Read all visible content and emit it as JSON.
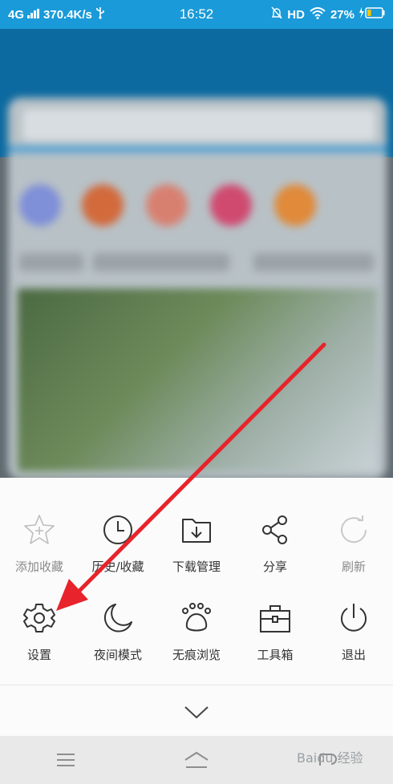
{
  "status_bar": {
    "network": "4G",
    "speed": "370.4K/s",
    "time": "16:52",
    "right_text": "HD",
    "battery": "27%",
    "battery_level": 0.27
  },
  "menu": {
    "rows": [
      [
        {
          "label": "添加收藏",
          "icon": "star-plus-icon",
          "enabled": false
        },
        {
          "label": "历史/收藏",
          "icon": "clock-icon",
          "enabled": true
        },
        {
          "label": "下载管理",
          "icon": "folder-download-icon",
          "enabled": true
        },
        {
          "label": "分享",
          "icon": "share-icon",
          "enabled": true
        },
        {
          "label": "刷新",
          "icon": "refresh-icon",
          "enabled": false
        }
      ],
      [
        {
          "label": "设置",
          "icon": "gear-icon",
          "enabled": true
        },
        {
          "label": "夜间模式",
          "icon": "moon-icon",
          "enabled": true
        },
        {
          "label": "无痕浏览",
          "icon": "paw-icon",
          "enabled": true
        },
        {
          "label": "工具箱",
          "icon": "toolbox-icon",
          "enabled": true
        },
        {
          "label": "退出",
          "icon": "power-icon",
          "enabled": true
        }
      ]
    ]
  },
  "watermark": "Baidu 经验",
  "colors": {
    "status_bar": "#1a9ad8",
    "header": "#0d6aa0",
    "arrow": "#e8232b"
  }
}
